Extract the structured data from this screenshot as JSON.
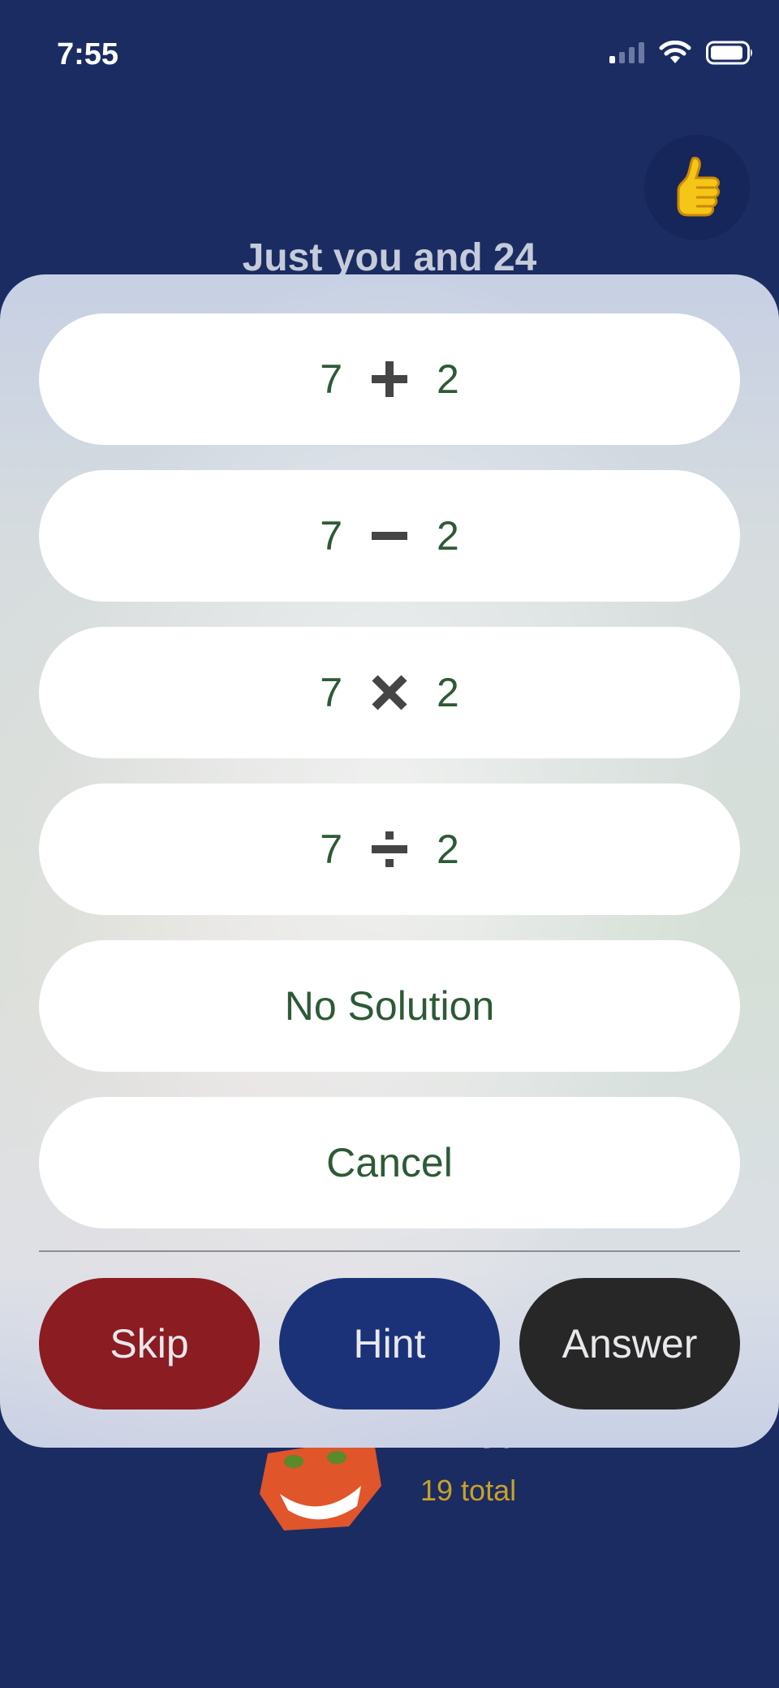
{
  "status_bar": {
    "time": "7:55",
    "icons": [
      "signal-icon",
      "wifi-icon",
      "battery-icon"
    ]
  },
  "header": {
    "title": "Just you and 24",
    "thumb_icon": "thumbs-up-icon"
  },
  "player": {
    "name": "Khed",
    "total": "19 total"
  },
  "options": [
    {
      "left": "7",
      "operator": "plus-icon",
      "right": "2"
    },
    {
      "left": "7",
      "operator": "minus-icon",
      "right": "2"
    },
    {
      "left": "7",
      "operator": "times-icon",
      "right": "2"
    },
    {
      "left": "7",
      "operator": "divide-icon",
      "right": "2"
    }
  ],
  "no_solution_label": "No Solution",
  "cancel_label": "Cancel",
  "actions": {
    "skip_label": "Skip",
    "hint_label": "Hint",
    "answer_label": "Answer"
  },
  "colors": {
    "background": "#1b2c63",
    "skip": "#8b1c22",
    "hint": "#1b3278",
    "answer": "#272727",
    "option_text": "#2d5a36",
    "total_text": "#c9a126"
  }
}
